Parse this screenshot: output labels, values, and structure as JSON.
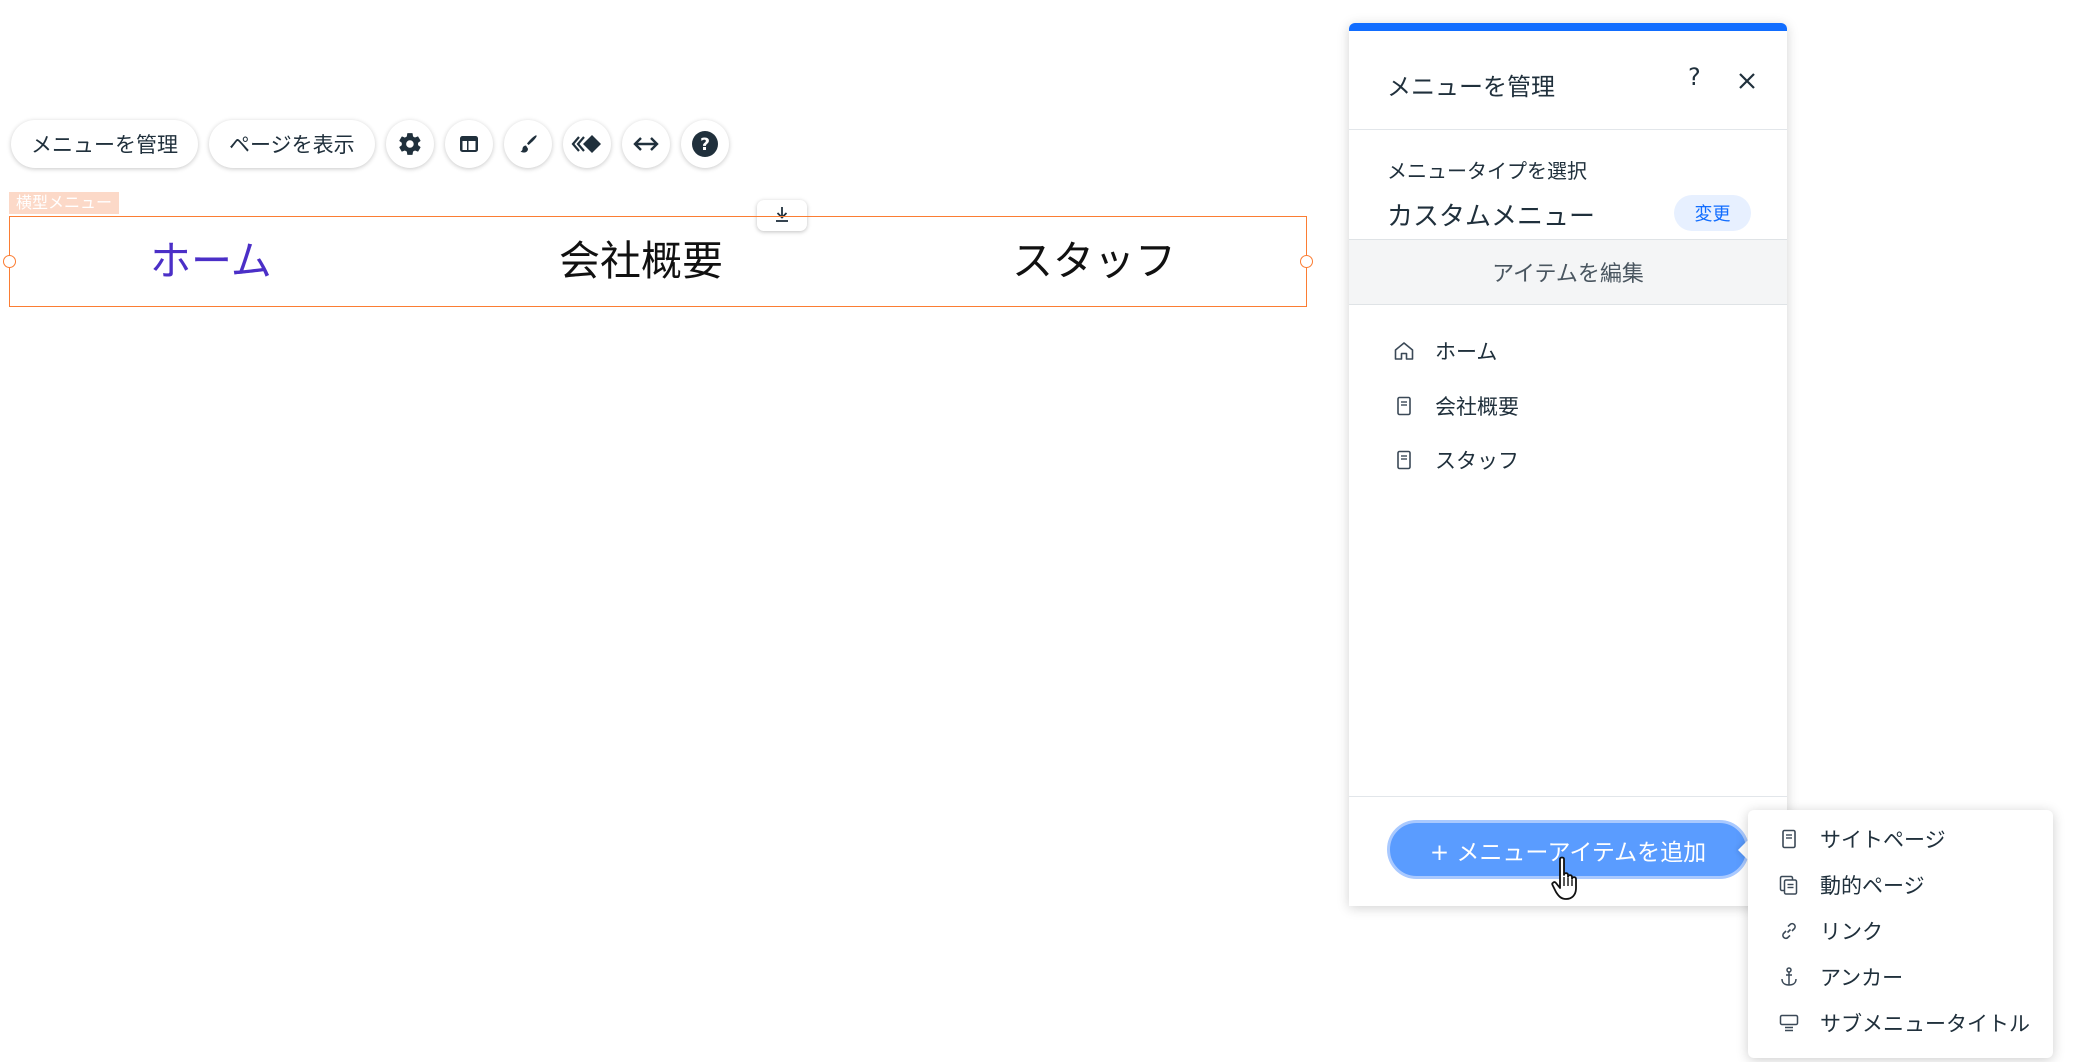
{
  "toolbar": {
    "manage_menu_label": "メニューを管理",
    "show_pages_label": "ページを表示",
    "icons": [
      "settings-icon",
      "layout-icon",
      "design-brush-icon",
      "animation-icon",
      "stretch-icon",
      "help-icon"
    ]
  },
  "canvas": {
    "component_tag": "横型メニュー",
    "menu_items": [
      "ホーム",
      "会社概要",
      "スタッフ"
    ],
    "active_item_color": "#4b2fc7",
    "selection_color": "#fb7d33"
  },
  "panel": {
    "title": "メニューを管理",
    "help_symbol": "?",
    "type_label": "メニュータイプを選択",
    "type_value": "カスタムメニュー",
    "change_label": "変更",
    "section_label": "アイテムを編集",
    "items": [
      {
        "label": "ホーム",
        "icon": "home-icon"
      },
      {
        "label": "会社概要",
        "icon": "page-icon"
      },
      {
        "label": "スタッフ",
        "icon": "page-icon"
      }
    ],
    "add_button_label": "+ メニューアイテムを追加",
    "accent_color": "#116dff"
  },
  "dropdown": {
    "items": [
      {
        "label": "サイトページ",
        "icon": "page-icon"
      },
      {
        "label": "動的ページ",
        "icon": "dynamic-page-icon"
      },
      {
        "label": "リンク",
        "icon": "link-icon"
      },
      {
        "label": "アンカー",
        "icon": "anchor-icon"
      },
      {
        "label": "サブメニュータイトル",
        "icon": "submenu-title-icon"
      }
    ]
  }
}
